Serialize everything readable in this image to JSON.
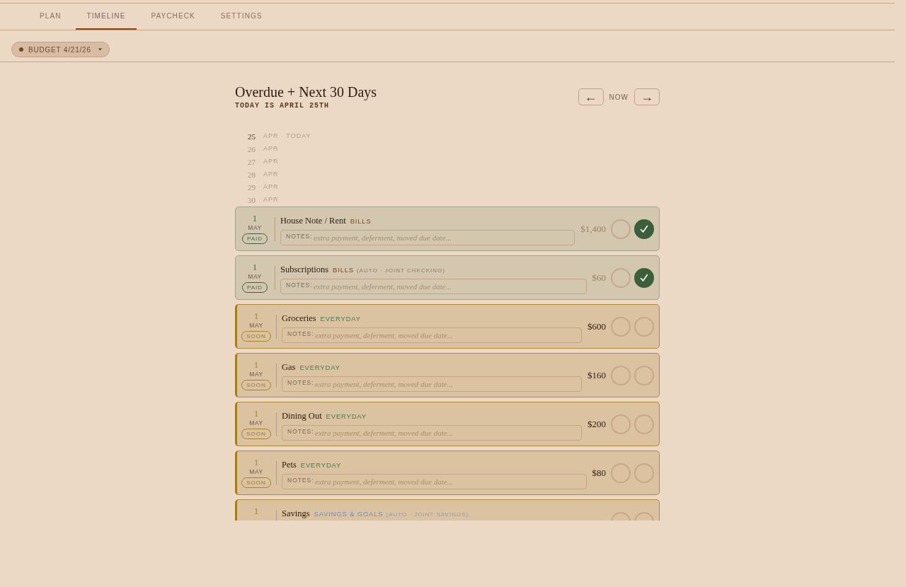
{
  "tabs": [
    {
      "label": "PLAN",
      "selected": false
    },
    {
      "label": "TIMELINE",
      "selected": true
    },
    {
      "label": "PAYCHECK",
      "selected": false
    },
    {
      "label": "SETTINGS",
      "selected": false
    }
  ],
  "budget_selector": {
    "label": "BUDGET 4/21/26"
  },
  "header": {
    "title": "Overdue + Next 30 Days",
    "subtitle": "TODAY IS APRIL 25TH",
    "prev": "←",
    "now": "NOW",
    "next": "→"
  },
  "timeline_days": [
    {
      "day": "25",
      "label": "APR · TODAY",
      "today": true
    },
    {
      "day": "26",
      "label": "APR",
      "today": false
    },
    {
      "day": "27",
      "label": "APR",
      "today": false
    },
    {
      "day": "28",
      "label": "APR",
      "today": false
    },
    {
      "day": "29",
      "label": "APR",
      "today": false
    },
    {
      "day": "30",
      "label": "APR",
      "today": false
    }
  ],
  "bills": [
    {
      "kind": "paid",
      "day": "1",
      "month": "MAY",
      "badge": "PAID",
      "name": "House Note / Rent",
      "category": {
        "label": "BILLS",
        "kind": "bills"
      },
      "notes": {
        "label": "NOTES:",
        "placeholder": "extra payment, deferment, moved due date..."
      },
      "amount": "$1,400",
      "toggles": [
        {
          "checked": false
        },
        {
          "checked": true
        }
      ]
    },
    {
      "kind": "paid",
      "day": "1",
      "month": "MAY",
      "badge": "PAID",
      "name": "Subscriptions",
      "category": {
        "label": "BILLS",
        "kind": "bills"
      },
      "auto": "(AUTO · JOINT CHECKING)",
      "notes": {
        "label": "NOTES:",
        "placeholder": "extra payment, deferment, moved due date..."
      },
      "amount": "$60",
      "toggles": [
        {
          "checked": false
        },
        {
          "checked": true
        }
      ]
    },
    {
      "kind": "soon",
      "day": "1",
      "month": "MAY",
      "badge": "SOON",
      "name": "Groceries",
      "category": {
        "label": "EVERYDAY",
        "kind": "everyday"
      },
      "notes": {
        "label": "NOTES:",
        "placeholder": "extra payment, deferment, moved due date..."
      },
      "amount": "$600",
      "toggles": [
        {
          "checked": false
        },
        {
          "checked": false
        }
      ]
    },
    {
      "kind": "soon",
      "day": "1",
      "month": "MAY",
      "badge": "SOON",
      "name": "Gas",
      "category": {
        "label": "EVERYDAY",
        "kind": "everyday"
      },
      "notes": {
        "label": "NOTES:",
        "placeholder": "extra payment, deferment, moved due date..."
      },
      "amount": "$160",
      "toggles": [
        {
          "checked": false
        },
        {
          "checked": false
        }
      ]
    },
    {
      "kind": "soon",
      "day": "1",
      "month": "MAY",
      "badge": "SOON",
      "name": "Dining Out",
      "category": {
        "label": "EVERYDAY",
        "kind": "everyday"
      },
      "notes": {
        "label": "NOTES:",
        "placeholder": "extra payment, deferment, moved due date..."
      },
      "amount": "$200",
      "toggles": [
        {
          "checked": false
        },
        {
          "checked": false
        }
      ]
    },
    {
      "kind": "soon",
      "day": "1",
      "month": "MAY",
      "badge": "SOON",
      "name": "Pets",
      "category": {
        "label": "EVERYDAY",
        "kind": "everyday"
      },
      "notes": {
        "label": "NOTES:",
        "placeholder": "extra payment, deferment, moved due date..."
      },
      "amount": "$80",
      "toggles": [
        {
          "checked": false
        },
        {
          "checked": false
        }
      ]
    },
    {
      "kind": "soon",
      "day": "1",
      "name": "Savings",
      "category": {
        "label": "SAVINGS & GOALS",
        "kind": "savings"
      },
      "auto": "(AUTO · JOINT SAVINGS)",
      "toggles": [
        {
          "checked": false
        },
        {
          "checked": false
        }
      ]
    }
  ]
}
